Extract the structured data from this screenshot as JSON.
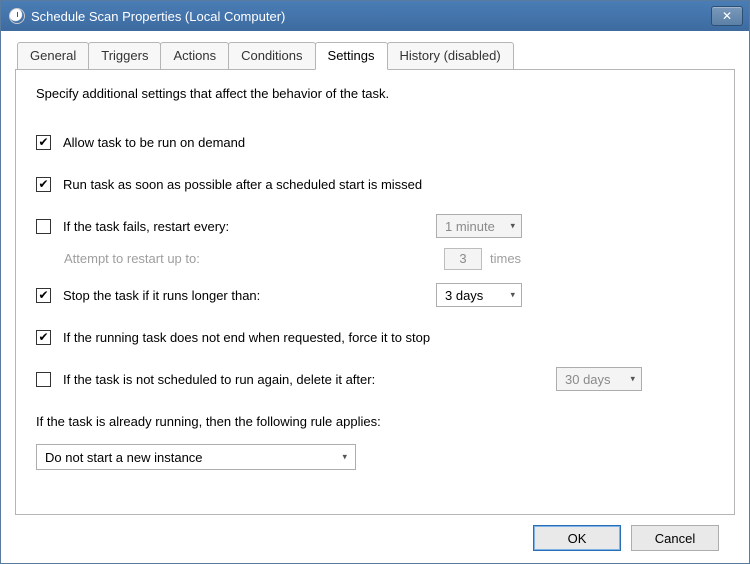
{
  "window": {
    "title": "Schedule Scan Properties (Local Computer)"
  },
  "tabs": {
    "general": "General",
    "triggers": "Triggers",
    "actions": "Actions",
    "conditions": "Conditions",
    "settings": "Settings",
    "history": "History (disabled)"
  },
  "panel": {
    "description": "Specify additional settings that affect the behavior of the task.",
    "allow_on_demand": {
      "checked": true,
      "label": "Allow task to be run on demand"
    },
    "run_asap": {
      "checked": true,
      "label": "Run task as soon as possible after a scheduled start is missed"
    },
    "restart_if_fail": {
      "checked": false,
      "label": "If the task fails, restart every:",
      "value": "1 minute"
    },
    "attempt_restart": {
      "label": "Attempt to restart up to:",
      "value": "3",
      "suffix": "times"
    },
    "stop_if_longer": {
      "checked": true,
      "label": "Stop the task if it runs longer than:",
      "value": "3 days"
    },
    "force_stop": {
      "checked": true,
      "label": "If the running task does not end when requested, force it to stop"
    },
    "delete_if_not": {
      "checked": false,
      "label": "If the task is not scheduled to run again, delete it after:",
      "value": "30 days"
    },
    "already_running_label": "If the task is already running, then the following rule applies:",
    "already_running_value": "Do not start a new instance"
  },
  "buttons": {
    "ok": "OK",
    "cancel": "Cancel"
  }
}
